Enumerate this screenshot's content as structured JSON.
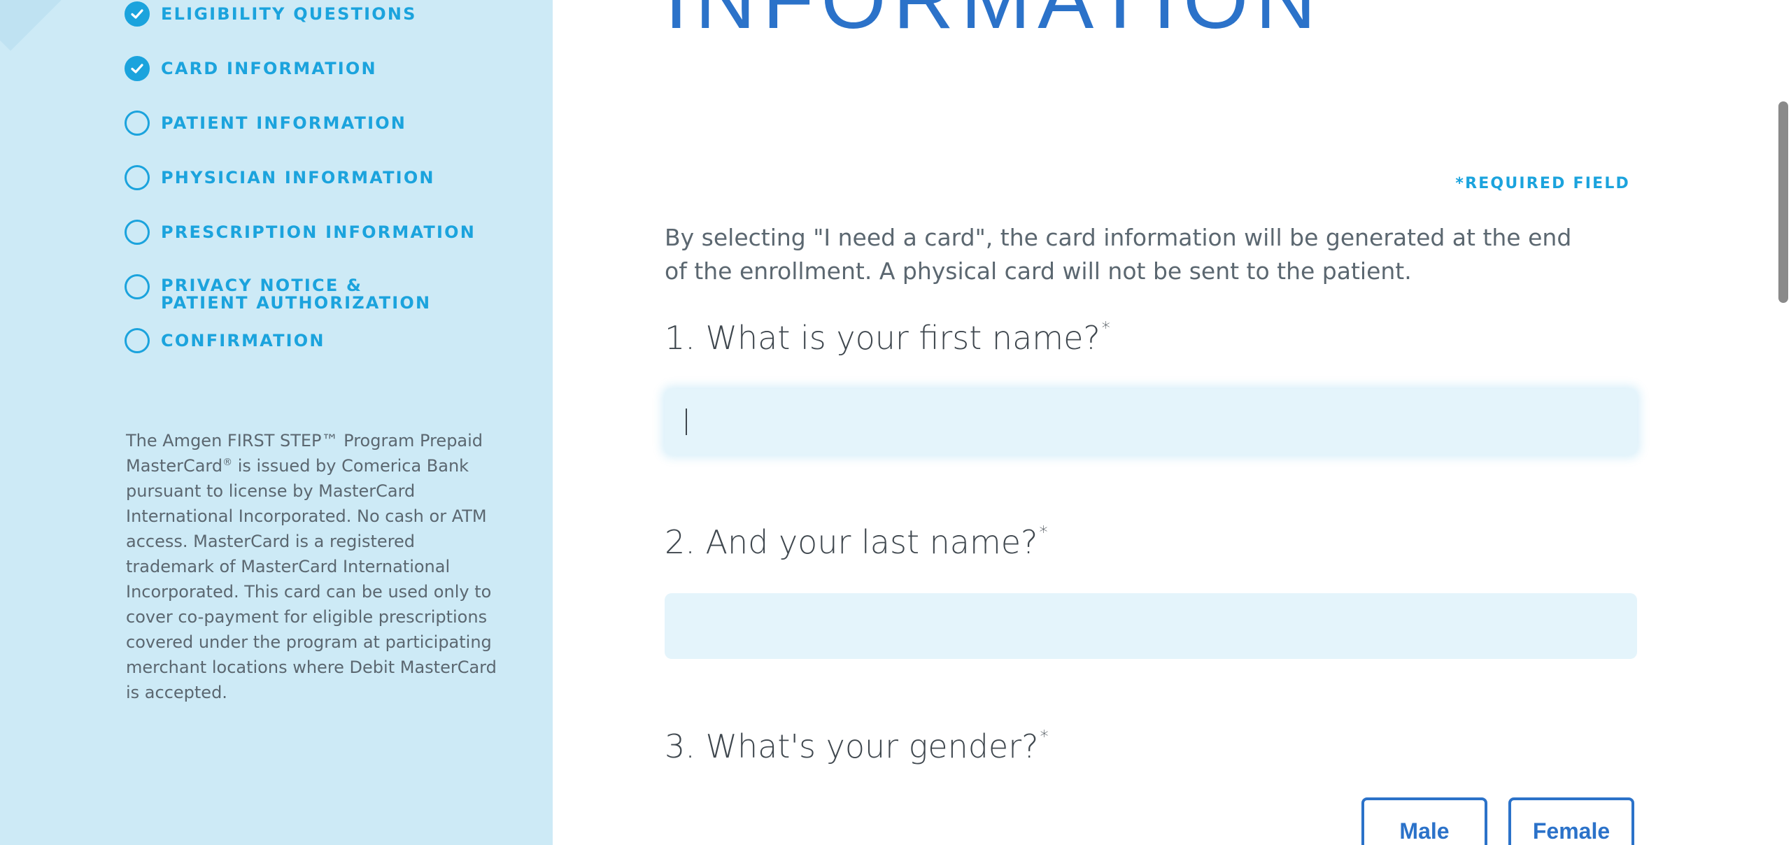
{
  "sidebar": {
    "steps": [
      {
        "label": "ELIGIBILITY QUESTIONS",
        "status": "done"
      },
      {
        "label": "CARD INFORMATION",
        "status": "done"
      },
      {
        "label": "PATIENT INFORMATION",
        "status": "pending"
      },
      {
        "label": "PHYSICIAN INFORMATION",
        "status": "pending"
      },
      {
        "label": "PRESCRIPTION INFORMATION",
        "status": "pending"
      },
      {
        "label_line1": "PRIVACY NOTICE &",
        "label_line2": "PATIENT AUTHORIZATION",
        "status": "pending"
      },
      {
        "label": "CONFIRMATION",
        "status": "pending"
      }
    ],
    "disclaimer": {
      "part1": "The Amgen FIRST STEP™ Program Prepaid MasterCard",
      "reg": "®",
      "part2": " is issued by Comerica Bank pursuant to license by MasterCard International Incorporated. No cash or ATM access. MasterCard is a registered trademark of MasterCard International Incorporated. This card can be used only to cover co-payment for eligible prescriptions covered under the program at participating merchant locations where Debit MasterCard is accepted."
    }
  },
  "main": {
    "heading": "INFORMATION",
    "required_note": "*REQUIRED FIELD",
    "intro": "By selecting \"I need a card\", the card information will be generated at the end of the enrollment. A physical card will not be sent to the patient.",
    "questions": [
      {
        "text": "1. What is your first name?",
        "marker": "*",
        "value": ""
      },
      {
        "text": "2. And your last name?",
        "marker": "*",
        "value": ""
      },
      {
        "text": "3. What's your gender?",
        "marker": "*"
      }
    ],
    "gender_options": [
      "Male",
      "Female"
    ]
  },
  "colors": {
    "sidebar_bg": "#cdeaf6",
    "accent": "#1ba3dd",
    "heading_blue": "#2b72c9",
    "field_bg": "#e4f4fb",
    "body_text": "#5b6770"
  },
  "icons": {
    "done": "check-circle-icon",
    "pending": "empty-circle-icon"
  }
}
